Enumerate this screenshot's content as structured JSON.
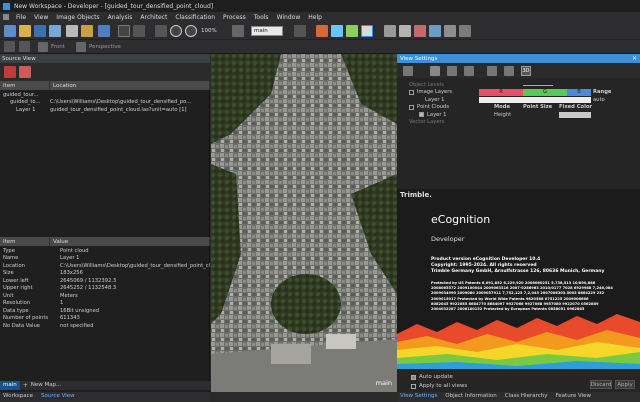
{
  "window": {
    "title": "New Workspace - Developer - [guided_tour_densified_point_cloud]"
  },
  "menu": [
    "File",
    "View",
    "Image Objects",
    "Analysis",
    "Architect",
    "Classification",
    "Process",
    "Tools",
    "Window",
    "Help"
  ],
  "toolbar": {
    "zoom_value": "100%",
    "map_select": "main",
    "front_label": "Front",
    "perspective_label": "Perspective"
  },
  "source_view": {
    "title": "Source View",
    "columns": [
      "Item",
      "Location"
    ],
    "rows": [
      {
        "item": "guided_tour...",
        "location": ""
      },
      {
        "item": "guided_to...",
        "location": "C:\\Users\\Williams\\Desktop\\guided_tour_densified_po..."
      },
      {
        "item": "Layer 1",
        "location": "guided_tour_densified_point_cloud.las?unit=auto [1]"
      }
    ]
  },
  "properties": {
    "columns": [
      "Item",
      "Value"
    ],
    "rows": [
      {
        "item": "Type",
        "value": "Point cloud"
      },
      {
        "item": "Name",
        "value": "Layer 1"
      },
      {
        "item": "Location",
        "value": "C:\\Users\\Williams\\Desktop\\guided_tour_densified_point_cl..."
      },
      {
        "item": "Size",
        "value": "183x256"
      },
      {
        "item": "Lower left",
        "value": "2645069 / 1132392.3"
      },
      {
        "item": "Upper right",
        "value": "2645252 / 1132548.3"
      },
      {
        "item": "Unit",
        "value": "Meters"
      },
      {
        "item": "Resolution",
        "value": "1"
      },
      {
        "item": "Data type",
        "value": "16Bit unsigned"
      },
      {
        "item": "Number of points",
        "value": "611343"
      },
      {
        "item": "No Data Value",
        "value": "not specified"
      }
    ]
  },
  "left_footer": {
    "map_tab": "main",
    "new_map": "New Map...",
    "tabs": [
      "Workspace",
      "Source View"
    ]
  },
  "map": {
    "label": "main"
  },
  "view_settings": {
    "title": "View Settings",
    "mode_button": "3D",
    "object_levels": "Object Levels",
    "image_layers": "Image Layers",
    "layer1": "Layer 1",
    "rgb": [
      "R",
      "G",
      "B"
    ],
    "range_label": "Range",
    "range_value": "auto",
    "point_clouds": "Point Clouds",
    "mode_col": "Mode",
    "point_size_col": "Point Size",
    "fixed_color_col": "Fixed Color",
    "pc_layer": "Layer 1",
    "pc_mode": "Height",
    "vector_layers": "Vector Layers"
  },
  "splash": {
    "brand": "Trimble.",
    "product": "eCognition",
    "edition": "Developer",
    "version": "Product version eCognition Developer 10.4",
    "copyright": "Copyright: 1995-2024. All rights reserved",
    "company": "Trimble Germany GmbH, Arnulfstrasse 126, 80636 Munich, Germany",
    "patents": [
      "Protected by US Patents 6,091,852 6,229,920 2006080251 5,738,513 10/890,886",
      "2008065572 2009100044 2009063316 2007-0286963 2010/0177 7028 6929988 7,246,084",
      "2009034990 2009080 2009057911 7,752,125 7,2,045 2007006303.5005 8664229 232",
      "2009015017 Protected by World Wide Patents 9620588 0751225 2009006666",
      "8082045 9922085 8684770 8684097 9927066 9927068 9957080 9922070 0562889",
      "2004032287 2006100152 Protected by European Patents 0858051 0962865"
    ]
  },
  "vs_footer": {
    "auto_update": "Auto update",
    "apply_all": "Apply to all views",
    "discard": "Discard",
    "apply": "Apply",
    "tabs": [
      "View Settings",
      "Object Information",
      "Class Hierarchy",
      "Feature View"
    ]
  },
  "colors": {
    "accent": "#3c8fd9",
    "r": "#e0516c",
    "g": "#59c75a",
    "b": "#4c89d8"
  }
}
